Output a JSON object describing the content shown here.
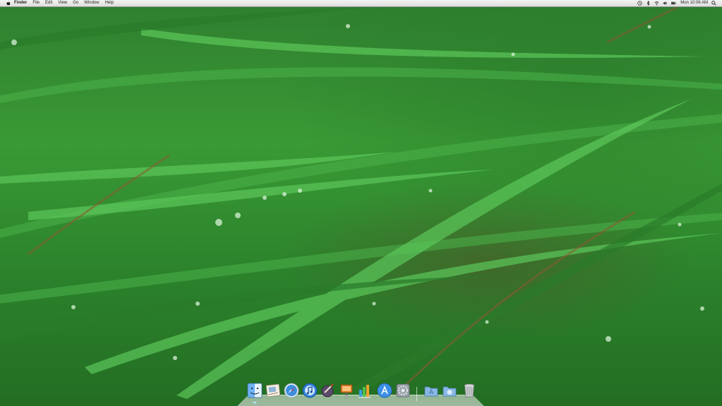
{
  "menubar": {
    "app_name": "Finder",
    "items": [
      "File",
      "Edit",
      "View",
      "Go",
      "Window",
      "Help"
    ],
    "clock": "Mon 10:06 AM"
  },
  "icons": {
    "apple": "apple-logo-icon",
    "time_machine": "time-machine-icon",
    "bluetooth": "bluetooth-icon",
    "wifi": "wifi-icon",
    "volume": "volume-icon",
    "battery": "battery-icon",
    "spotlight": "spotlight-icon"
  },
  "dock": {
    "items": [
      "finder",
      "mail",
      "safari",
      "itunes",
      "preview",
      "iphoto",
      "dashboard",
      "app-store",
      "system-preferences",
      "applications",
      "downloads",
      "trash"
    ]
  },
  "colors": {
    "wallpaper_green": "#2f8a2f",
    "menubar_bg": "#e6e6e6"
  }
}
